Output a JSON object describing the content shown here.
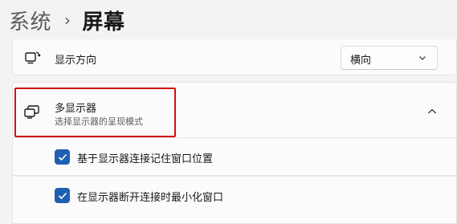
{
  "breadcrumb": {
    "parent": "系统",
    "separator": "›",
    "current": "屏幕"
  },
  "orientation": {
    "label": "显示方向",
    "value": "横向",
    "icon": "display-rotate-icon"
  },
  "multi_display": {
    "title": "多显示器",
    "description": "选择显示器的呈现模式",
    "icon": "multiple-displays-icon",
    "expanded": true
  },
  "options": [
    {
      "label": "基于显示器连接记住窗口位置",
      "checked": true
    },
    {
      "label": "在显示器断开连接时最小化窗口",
      "checked": true
    }
  ],
  "colors": {
    "accent": "#1f5fb0",
    "highlight": "#d60f0f"
  }
}
